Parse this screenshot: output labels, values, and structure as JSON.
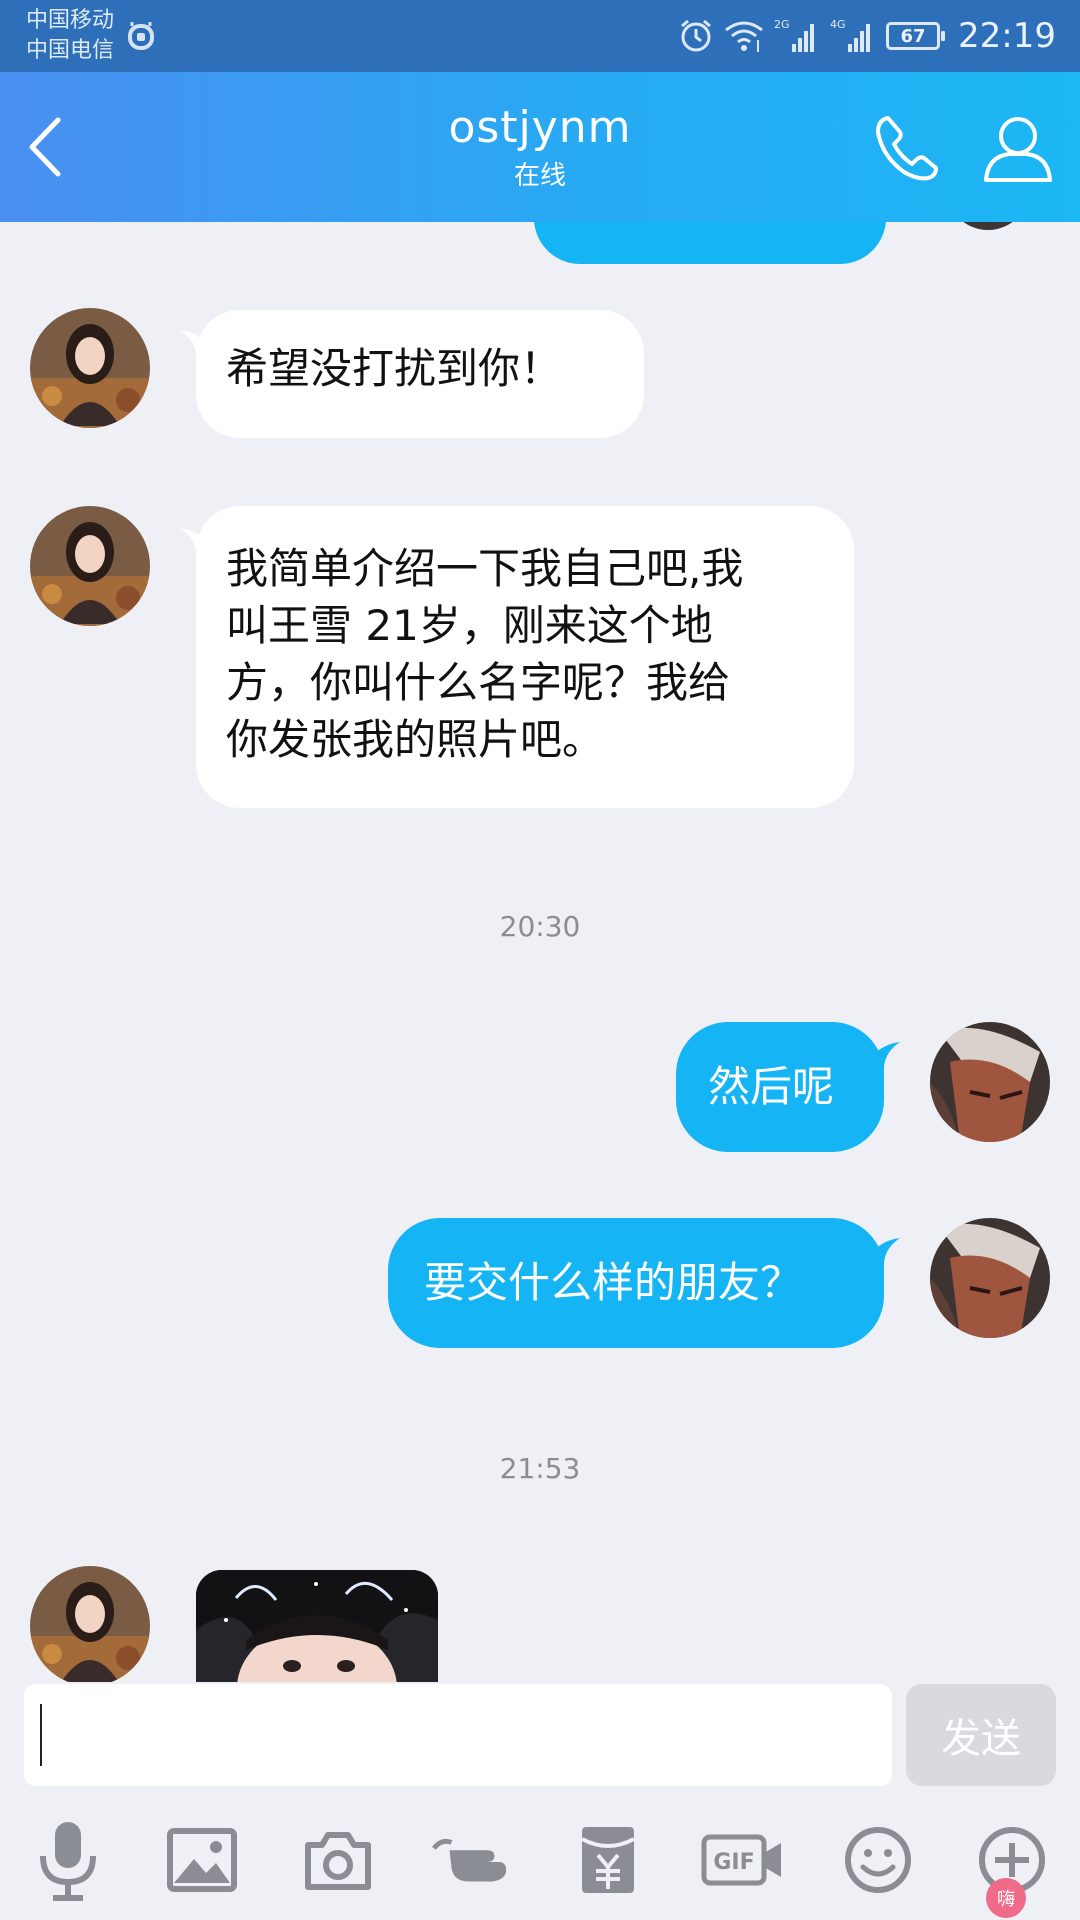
{
  "status_bar": {
    "carriers": [
      "中国移动",
      "中国电信"
    ],
    "network_types": [
      "2G",
      "4G"
    ],
    "battery": "67",
    "time": "22:19"
  },
  "header": {
    "title": "ostjynm",
    "subtitle": "在线"
  },
  "messages": [
    {
      "direction": "in",
      "text": "希望没打扰到你！"
    },
    {
      "direction": "in",
      "lines": [
        "我简单介绍一下我自己吧,我",
        "叫王雪 21岁，刚来这个地",
        "方，你叫什么名字呢？我给",
        "你发张我的照片吧。"
      ]
    },
    {
      "direction": "out",
      "text": "然后呢"
    },
    {
      "direction": "out",
      "text": "要交什么样的朋友？"
    },
    {
      "direction": "in",
      "type": "photo"
    }
  ],
  "timestamps": [
    "20:30",
    "21:53"
  ],
  "input": {
    "value": "",
    "send_label": "发送"
  },
  "toolbar": {
    "gif_label": "GIF",
    "items": [
      "microphone-icon",
      "image-icon",
      "camera-icon",
      "poke-icon",
      "red-packet-icon",
      "gif-icon",
      "emoji-icon",
      "plus-icon"
    ]
  },
  "badge": {
    "label": "嗨"
  },
  "colors": {
    "header_start": "#4a8ff1",
    "header_end": "#1cb7f5",
    "outgoing_bubble": "#15b5f5",
    "incoming_bubble": "#ffffff",
    "background": "#eff0f5",
    "send_button_disabled": "#d9dadf"
  }
}
